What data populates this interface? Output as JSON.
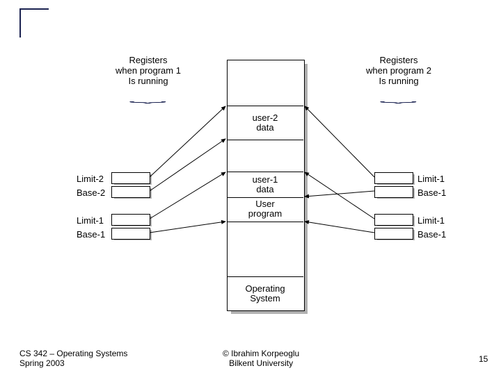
{
  "header_left": "Registers\nwhen program 1\nIs running",
  "header_right": "Registers\nwhen program 2\nIs running",
  "mem": {
    "user2": "user-2\ndata",
    "user1": "user-1\ndata",
    "prog": "User\nprogram",
    "os": "Operating\nSystem"
  },
  "left_regs": [
    "Limit-2",
    "Base-2",
    "Limit-1",
    "Base-1"
  ],
  "right_regs": [
    "Limit-1",
    "Base-1",
    "Limit-1",
    "Base-1"
  ],
  "footer_left": "CS 342 – Operating Systems\nSpring 2003",
  "footer_center": "© Ibrahim Korpeoglu\nBilkent University",
  "footer_right": "15"
}
